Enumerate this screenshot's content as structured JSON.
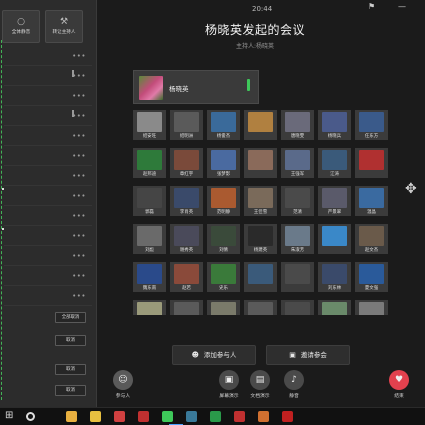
{
  "status_bar": {
    "time": "20:44"
  },
  "window_controls": {
    "pin": "⚑",
    "minimize": "—"
  },
  "left_panel": {
    "mute_all": {
      "icon": "mic-off-icon",
      "glyph": "○",
      "label": "全体静音"
    },
    "transfer_host": {
      "icon": "wrench-icon",
      "glyph": "⚒",
      "label": "转让主持人"
    },
    "row_menu_glyph": "•••",
    "buttons": {
      "unmute_all": "全部取消",
      "cancel_1": "取消",
      "cancel_2": "取消",
      "cancel_3": "取消"
    }
  },
  "meeting": {
    "title": "杨晓英发起的会议",
    "subtitle": "主持人:杨晓英"
  },
  "main_video": {
    "name": "杨晓英",
    "level_color": "#3ec85a"
  },
  "participants": [
    {
      "name": "绍安旺",
      "color": "#8a8a8a"
    },
    {
      "name": "绍明洲",
      "color": "#5a5a5a"
    },
    {
      "name": "杨俊杰",
      "color": "#3a6a9a"
    },
    {
      "name": "",
      "color": "#b08040"
    },
    {
      "name": "唐晓雯",
      "color": "#6a6a7a"
    },
    {
      "name": "杨晓兵",
      "color": "#4a5a8a"
    },
    {
      "name": "任东方",
      "color": "#3a5a8a"
    },
    {
      "name": "赵邦迪",
      "color": "#2e7a3a"
    },
    {
      "name": "章红宇",
      "color": "#7a4a3a"
    },
    {
      "name": "张梦影",
      "color": "#4a6aa0"
    },
    {
      "name": "",
      "color": "#8a6a5a"
    },
    {
      "name": "王强军",
      "color": "#5a6a8a"
    },
    {
      "name": "江涛",
      "color": "#3a5a7a"
    },
    {
      "name": "",
      "color": "#b03030"
    },
    {
      "name": "郭磊",
      "color": "#454545"
    },
    {
      "name": "李肖英",
      "color": "#3a4a6a"
    },
    {
      "name": "范明静",
      "color": "#aa5a30"
    },
    {
      "name": "王佳雪",
      "color": "#7a6a5a"
    },
    {
      "name": "范清",
      "color": "#4a4a4a"
    },
    {
      "name": "严景翠",
      "color": "#5a5a6a"
    },
    {
      "name": "温晶",
      "color": "#3a6aa0"
    },
    {
      "name": "刘彪",
      "color": "#6a6a6a"
    },
    {
      "name": "谢秀英",
      "color": "#4a4a5a"
    },
    {
      "name": "刘倩",
      "color": "#3a4a3a"
    },
    {
      "name": "杨建英",
      "color": "#2a2a2a"
    },
    {
      "name": "朱淑芳",
      "color": "#6a7a8a"
    },
    {
      "name": "",
      "color": "#3a88c8"
    },
    {
      "name": "赵文杰",
      "color": "#6a5a4a"
    },
    {
      "name": "魏东南",
      "color": "#2a4a8a"
    },
    {
      "name": "赵若",
      "color": "#8a4a3a"
    },
    {
      "name": "史乐",
      "color": "#3a7a3a"
    },
    {
      "name": "",
      "color": "#3a5a7a"
    },
    {
      "name": "",
      "color": "#4a4a4a"
    },
    {
      "name": "刘东林",
      "color": "#3a4a6a"
    },
    {
      "name": "夏文强",
      "color": "#2a5a9a"
    },
    {
      "name": "",
      "color": "#9a9a7a"
    },
    {
      "name": "",
      "color": "#5a5a5a"
    },
    {
      "name": "",
      "color": "#7a7a6a"
    },
    {
      "name": "",
      "color": "#5a5a5a"
    },
    {
      "name": "",
      "color": "#4a4a4a"
    },
    {
      "name": "",
      "color": "#6a8a6a"
    },
    {
      "name": "",
      "color": "#7a7a7a"
    }
  ],
  "actions": {
    "add_participant": "添加参与人",
    "invite": "邀请参会"
  },
  "toolbar": {
    "participants": {
      "icon": "person-icon",
      "glyph": "☺",
      "label": "参与人"
    },
    "screen_share": {
      "icon": "screen-icon",
      "glyph": "▣",
      "label": "屏幕演示"
    },
    "doc_share": {
      "icon": "document-icon",
      "glyph": "▤",
      "label": "文档演示"
    },
    "mic": {
      "icon": "mic-icon",
      "glyph": "♪",
      "label": "静音"
    },
    "end": {
      "icon": "hang-up-icon",
      "glyph": "♥",
      "label": "结束"
    }
  },
  "taskbar": {
    "start_glyph": "⊞",
    "apps": [
      {
        "name": "chrome-icon",
        "color": "#e8b040"
      },
      {
        "name": "folder-icon",
        "color": "#e8c040"
      },
      {
        "name": "tool-icon",
        "color": "#d04040"
      },
      {
        "name": "stripe-icon",
        "color": "#c03030"
      },
      {
        "name": "wechat-icon",
        "color": "#3ec85a"
      },
      {
        "name": "meeting-app-icon",
        "color": "#3a7a9a"
      },
      {
        "name": "green-app-icon",
        "color": "#2a9a4a"
      },
      {
        "name": "red-app-icon",
        "color": "#c03030"
      },
      {
        "name": "orange-app-icon",
        "color": "#d07030"
      },
      {
        "name": "red2-app-icon",
        "color": "#c02020"
      }
    ]
  }
}
